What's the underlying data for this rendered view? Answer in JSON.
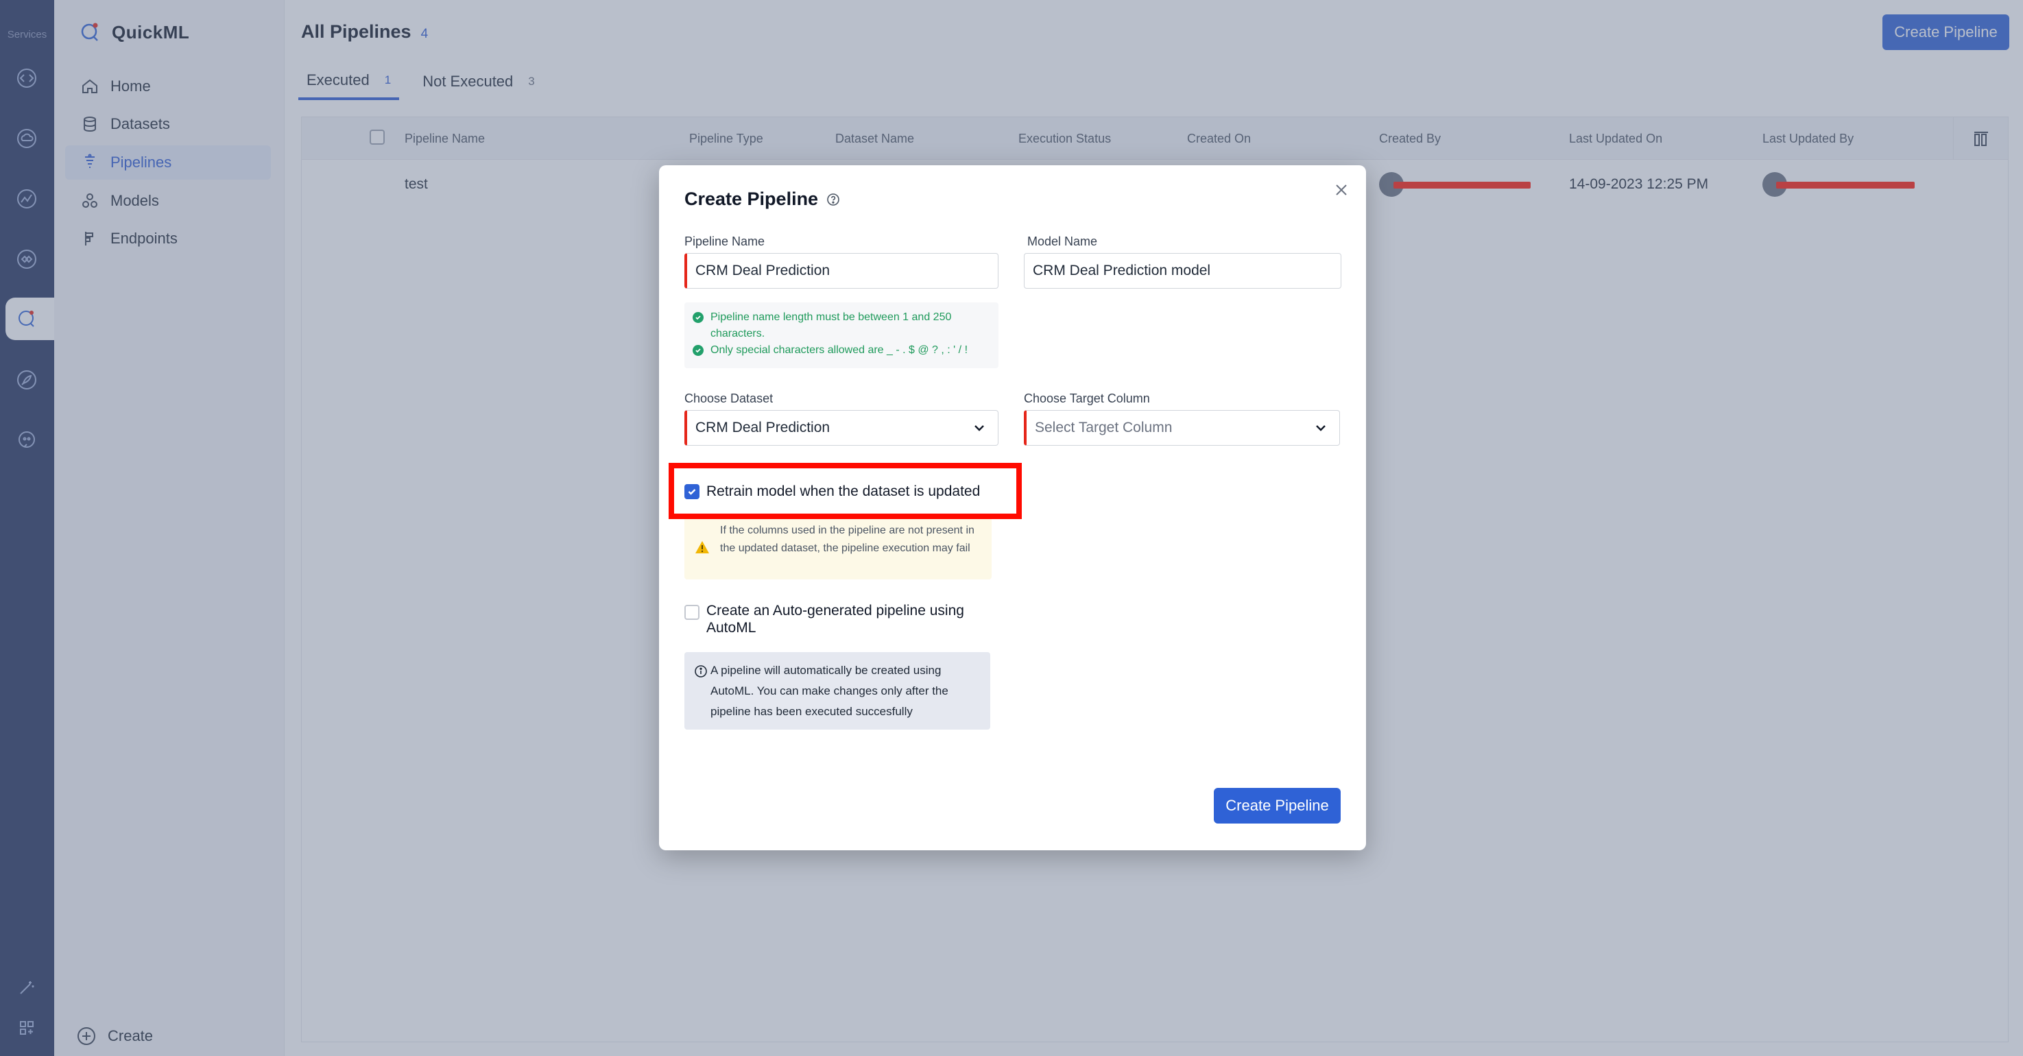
{
  "rail": {
    "title": "Services"
  },
  "sidebar": {
    "brand": "QuickML",
    "items": [
      {
        "label": "Home",
        "icon": "home-icon"
      },
      {
        "label": "Datasets",
        "icon": "database-icon"
      },
      {
        "label": "Pipelines",
        "icon": "pipeline-icon",
        "active": true
      },
      {
        "label": "Models",
        "icon": "models-icon"
      },
      {
        "label": "Endpoints",
        "icon": "endpoint-icon"
      }
    ],
    "create_label": "Create"
  },
  "header": {
    "title": "All Pipelines",
    "count": "4",
    "create_button": "Create Pipeline"
  },
  "tabs": [
    {
      "label": "Executed",
      "count": "1",
      "active": true
    },
    {
      "label": "Not Executed",
      "count": "3"
    }
  ],
  "table": {
    "columns": [
      "Pipeline Name",
      "Pipeline Type",
      "Dataset Name",
      "Execution Status",
      "Created On",
      "Created By",
      "Last Updated On",
      "Last Updated By"
    ],
    "rows": [
      {
        "pipeline_name": "test",
        "last_updated_on": "14-09-2023 12:25 PM"
      }
    ]
  },
  "modal": {
    "title": "Create Pipeline",
    "pipeline_name_label": "Pipeline Name",
    "pipeline_name_value": "CRM Deal Prediction",
    "model_name_label": "Model Name",
    "model_name_value": "CRM Deal Prediction model",
    "hints": [
      "Pipeline name length must be between 1 and 250 characters.",
      "Only special characters allowed are _ - . $ @ ? , : ' / !"
    ],
    "dataset_label": "Choose Dataset",
    "dataset_value": "CRM Deal Prediction",
    "target_label": "Choose Target Column",
    "target_placeholder": "Select Target Column",
    "retrain_label": "Retrain model when the dataset is updated",
    "retrain_checked": true,
    "warning": "If the columns used in the pipeline are not present in the updated dataset, the pipeline execution may fail",
    "automl_label": "Create an Auto-generated pipeline using AutoML",
    "automl_checked": false,
    "automl_info": "A pipeline will automatically be created using AutoML. You can make changes only after the pipeline has been executed succesfully",
    "submit_button": "Create Pipeline"
  },
  "colors": {
    "primary": "#2f62d6",
    "rail": "#25345e",
    "required": "#e5261a",
    "annotation": "#ff0a00",
    "success": "#22a06b"
  }
}
